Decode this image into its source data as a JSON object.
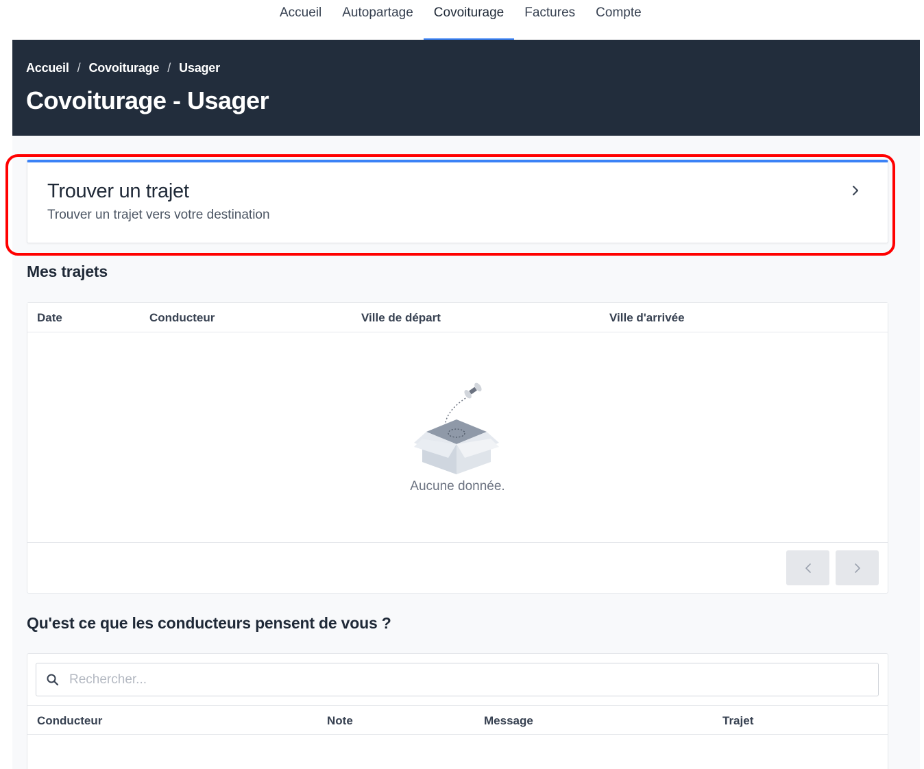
{
  "nav": {
    "items": [
      {
        "label": "Accueil"
      },
      {
        "label": "Autopartage"
      },
      {
        "label": "Covoiturage"
      },
      {
        "label": "Factures"
      },
      {
        "label": "Compte"
      }
    ],
    "active": "Covoiturage"
  },
  "header": {
    "breadcrumb": [
      "Accueil",
      "Covoiturage",
      "Usager"
    ],
    "breadcrumb_separator": "/",
    "title": "Covoiturage - Usager"
  },
  "find_trip": {
    "title": "Trouver un trajet",
    "subtitle": "Trouver un trajet vers votre destination"
  },
  "my_trips": {
    "title": "Mes trajets",
    "columns": [
      "Date",
      "Conducteur",
      "Ville de départ",
      "Ville d'arrivée"
    ],
    "rows": [],
    "empty_message": "Aucune donnée."
  },
  "reviews": {
    "title": "Qu'est ce que les conducteurs pensent de vous ?",
    "search_placeholder": "Rechercher...",
    "search_value": "",
    "columns": [
      "Conducteur",
      "Note",
      "Message",
      "Trajet"
    ]
  },
  "colors": {
    "header_bg": "#222d3c",
    "accent": "#3b82f6",
    "highlight": "#ff0000"
  }
}
